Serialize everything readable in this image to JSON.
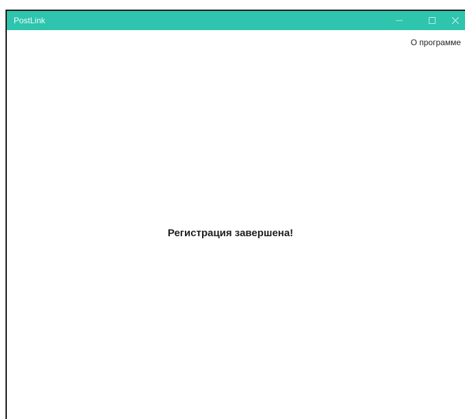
{
  "window": {
    "title": "PostLink",
    "titlebar_color": "#2ec4ae",
    "controls": {
      "minimize_icon": "minimize-icon",
      "maximize_icon": "maximize-icon",
      "close_icon": "close-icon"
    }
  },
  "header": {
    "about_label": "О программе"
  },
  "main": {
    "message": "Регистрация завершена!"
  }
}
